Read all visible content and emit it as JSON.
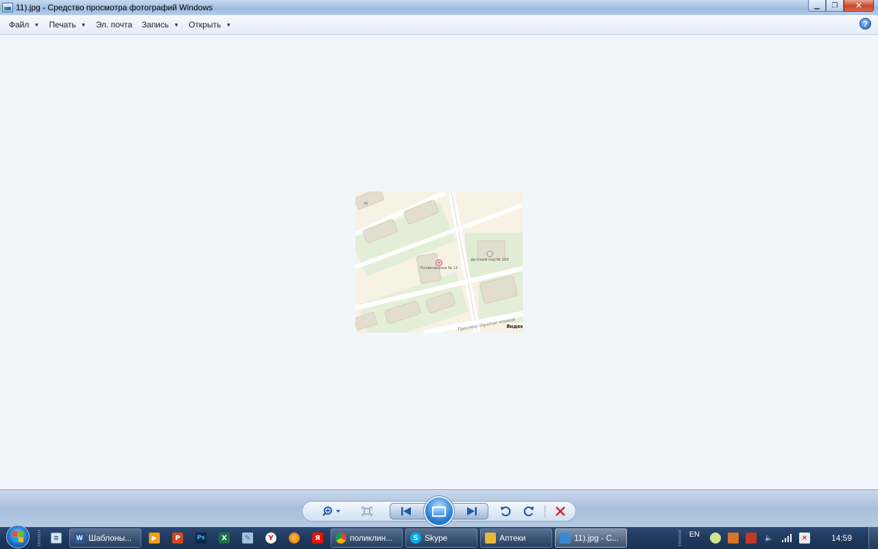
{
  "window": {
    "title": "11).jpg - Средство просмотра фотографий Windows",
    "controls": {
      "minimize_icon": "minimize-icon",
      "maximize_icon": "restore-icon",
      "close_icon": "close-icon"
    }
  },
  "menu": {
    "items": [
      {
        "label": "Файл",
        "has_dropdown": true
      },
      {
        "label": "Печать",
        "has_dropdown": true
      },
      {
        "label": "Эл. почта",
        "has_dropdown": false
      },
      {
        "label": "Запись",
        "has_dropdown": true
      },
      {
        "label": "Открыть",
        "has_dropdown": true
      }
    ],
    "help_label": "?"
  },
  "photo": {
    "map_labels": {
      "clinic": "Поликлиника № 11",
      "kindergarten": "Детский сад № 165",
      "street": "Проспект Oguzhan кошеси",
      "brand": "Яндекс",
      "house_number": "30"
    }
  },
  "controlbar": {
    "buttons": [
      "zoom-icon",
      "actual-size-icon",
      "previous-icon",
      "slideshow-icon",
      "next-icon",
      "rotate-left-icon",
      "rotate-right-icon",
      "delete-icon"
    ]
  },
  "taskbar": {
    "tasks": [
      {
        "label": "Шаблоны...",
        "icon": "W",
        "color": "#2b5797",
        "active": false
      },
      {
        "label": "поликлин...",
        "icon": "G",
        "color": "#dd4b39",
        "active": false
      },
      {
        "label": "Skype",
        "icon": "S",
        "color": "#00aff0",
        "active": false
      },
      {
        "label": "Аптеки",
        "icon": "F",
        "color": "#e8b83a",
        "active": false
      },
      {
        "label": "11).jpg - С...",
        "icon": "P",
        "color": "#3b8ad6",
        "active": true
      }
    ],
    "language": "EN",
    "clock": "14:59",
    "colors": {
      "taskbar": "#1f3a5f",
      "content_bg": "#f1f6fc"
    }
  }
}
